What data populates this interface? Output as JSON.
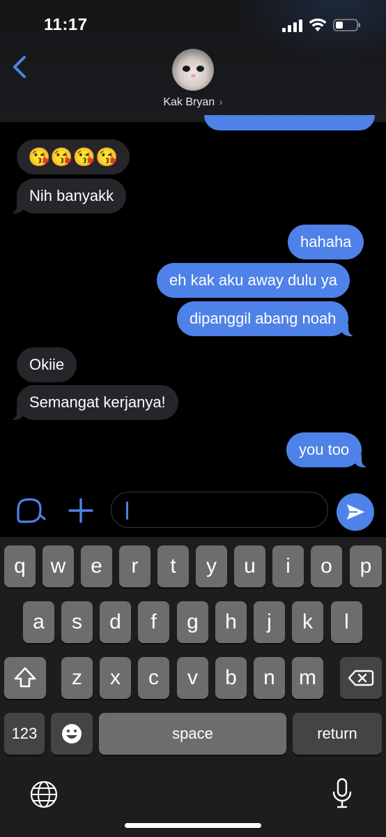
{
  "status": {
    "time": "11:17"
  },
  "header": {
    "contact_name": "Kak Bryan",
    "chevron": "›"
  },
  "messages": [
    {
      "side": "in",
      "text": "😘😘😘😘",
      "kind": "emoji"
    },
    {
      "side": "in",
      "text": "Nih banyakk"
    },
    {
      "side": "out",
      "text": "hahaha"
    },
    {
      "side": "out",
      "text": "eh kak aku away dulu ya"
    },
    {
      "side": "out",
      "text": "dipanggil abang noah"
    },
    {
      "side": "in",
      "text": "Okiie"
    },
    {
      "side": "in",
      "text": "Semangat kerjanya!"
    },
    {
      "side": "out",
      "text": "you too"
    }
  ],
  "input": {
    "value": ""
  },
  "keyboard": {
    "row1": [
      "q",
      "w",
      "e",
      "r",
      "t",
      "y",
      "u",
      "i",
      "o",
      "p"
    ],
    "row2": [
      "a",
      "s",
      "d",
      "f",
      "g",
      "h",
      "j",
      "k",
      "l"
    ],
    "row3": [
      "z",
      "x",
      "c",
      "v",
      "b",
      "n",
      "m"
    ],
    "numbers_label": "123",
    "space_label": "space",
    "return_label": "return"
  },
  "colors": {
    "accent": "#4f82e8",
    "incoming": "#26262a",
    "key": "#6d6d70",
    "key_dark": "#444447"
  },
  "icons": [
    "back-chevron-icon",
    "signal-icon",
    "wifi-icon",
    "battery-icon",
    "camera-icon",
    "plus-icon",
    "send-arrow-icon",
    "shift-icon",
    "delete-icon",
    "emoji-icon",
    "globe-icon",
    "microphone-icon"
  ]
}
